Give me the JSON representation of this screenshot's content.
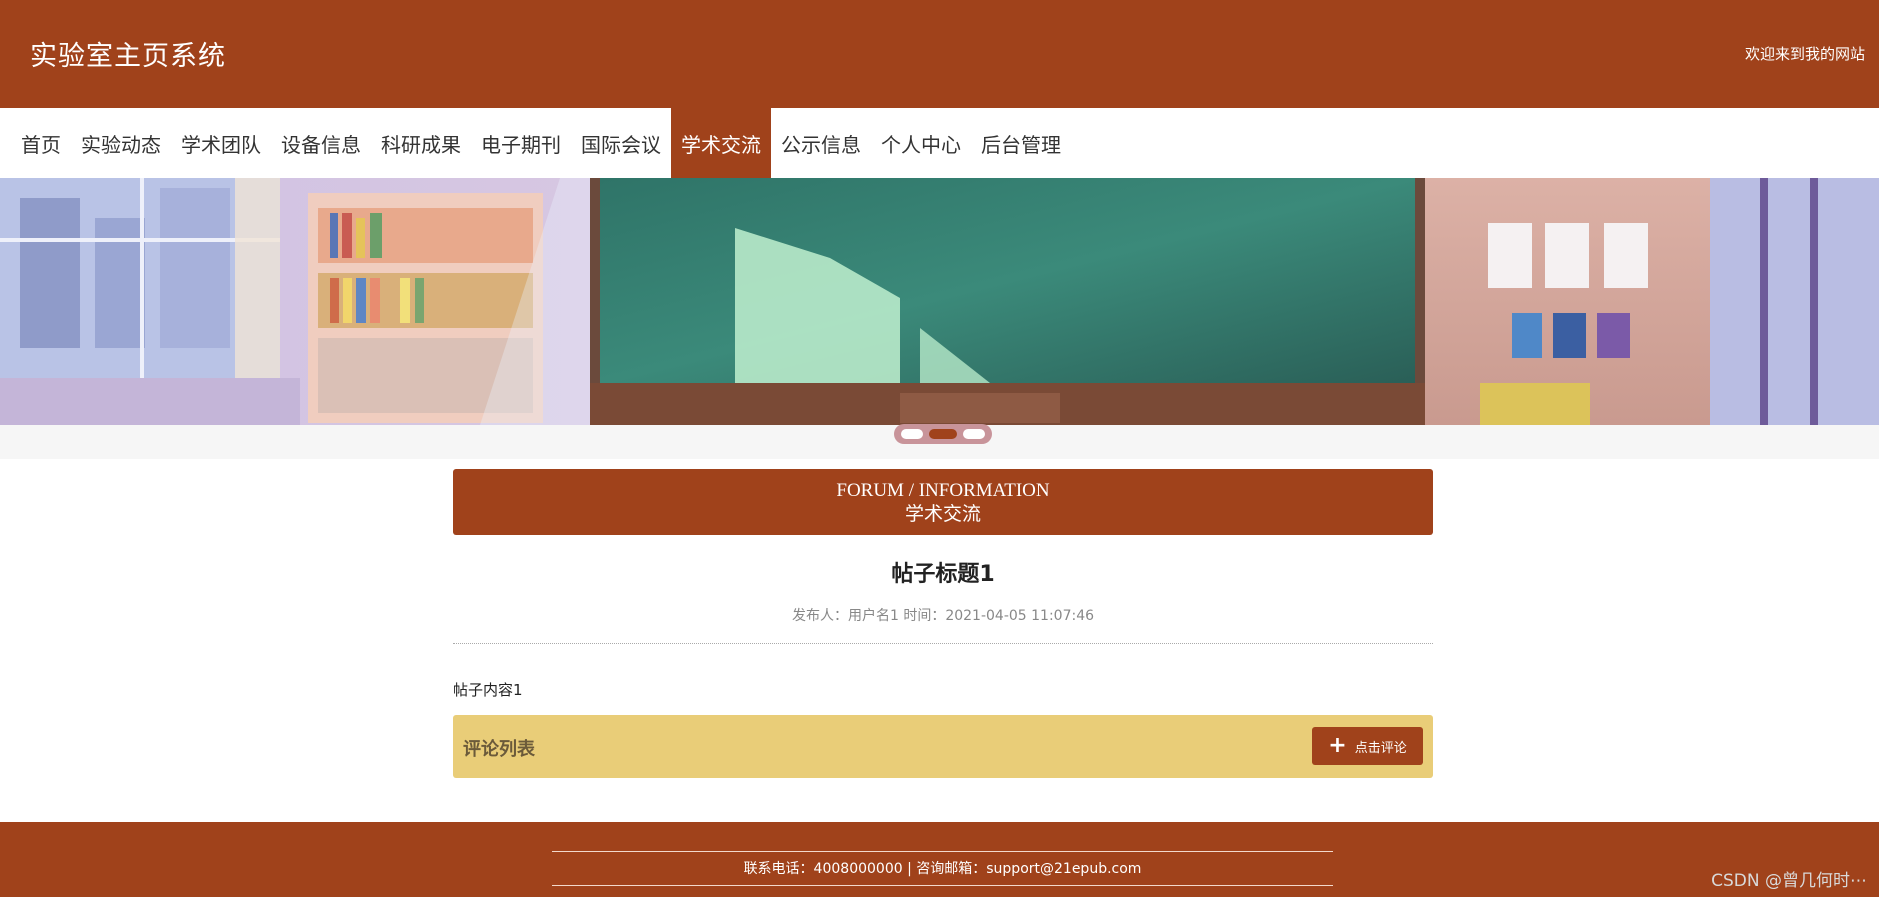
{
  "header": {
    "site_title": "实验室主页系统",
    "welcome": "欢迎来到我的网站"
  },
  "nav": {
    "items": [
      {
        "label": "首页"
      },
      {
        "label": "实验动态"
      },
      {
        "label": "学术团队"
      },
      {
        "label": "设备信息"
      },
      {
        "label": "科研成果"
      },
      {
        "label": "电子期刊"
      },
      {
        "label": "国际会议"
      },
      {
        "label": "学术交流",
        "active": true
      },
      {
        "label": "公示信息"
      },
      {
        "label": "个人中心"
      },
      {
        "label": "后台管理"
      }
    ]
  },
  "banner": {
    "slide_count": 3,
    "active_slide": 2
  },
  "section": {
    "title_en": "FORUM / INFORMATION",
    "title_cn": "学术交流"
  },
  "post": {
    "title": "帖子标题1",
    "meta": "发布人：用户名1 时间：2021-04-05 11:07:46",
    "content": "帖子内容1"
  },
  "comments": {
    "label": "评论列表",
    "button_label": "点击评论"
  },
  "footer": {
    "contact": "联系电话：4008000000 | 咨询邮箱：support@21epub.com"
  },
  "watermark": "CSDN @曾几何时⋯",
  "colors": {
    "brand": "#a0421b",
    "comment_bar": "#e9cd78"
  }
}
